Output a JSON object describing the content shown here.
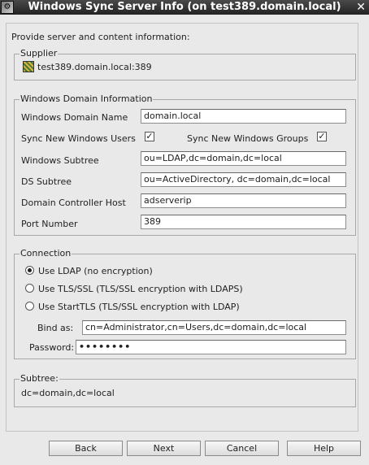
{
  "window": {
    "title": "Windows Sync Server Info (on test389.domain.local)",
    "close_glyph": "✕",
    "icon_glyph": "⚙"
  },
  "intro": "Provide server and content information:",
  "supplier": {
    "legend": "Supplier",
    "value": "test389.domain.local:389"
  },
  "domain": {
    "legend": "Windows Domain Information",
    "domain_name_label": "Windows Domain Name",
    "domain_name_value": "domain.local",
    "sync_users_label": "Sync New Windows Users",
    "sync_users_checked": true,
    "sync_groups_label": "Sync New Windows Groups",
    "sync_groups_checked": true,
    "check_glyph": "✓",
    "subtree_label": "Windows Subtree",
    "subtree_value": "ou=LDAP,dc=domain,dc=local",
    "ds_subtree_label": "DS Subtree",
    "ds_subtree_value": "ou=ActiveDirectory, dc=domain,dc=local",
    "dc_host_label": "Domain Controller Host",
    "dc_host_value": "adserverip",
    "port_label": "Port Number",
    "port_value": "389"
  },
  "connection": {
    "legend": "Connection",
    "options": [
      "Use LDAP (no encryption)",
      "Use TLS/SSL (TLS/SSL encryption with LDAPS)",
      "Use StartTLS (TLS/SSL encryption with LDAP)"
    ],
    "selected": "Use LDAP (no encryption)",
    "bind_label": "Bind as:",
    "bind_value": "cn=Administrator,cn=Users,dc=domain,dc=local",
    "password_label": "Password:",
    "password_value": "••••••••"
  },
  "subtree": {
    "legend": "Subtree:",
    "value": "dc=domain,dc=local"
  },
  "buttons": {
    "back": "Back",
    "next": "Next",
    "cancel": "Cancel",
    "help": "Help"
  }
}
